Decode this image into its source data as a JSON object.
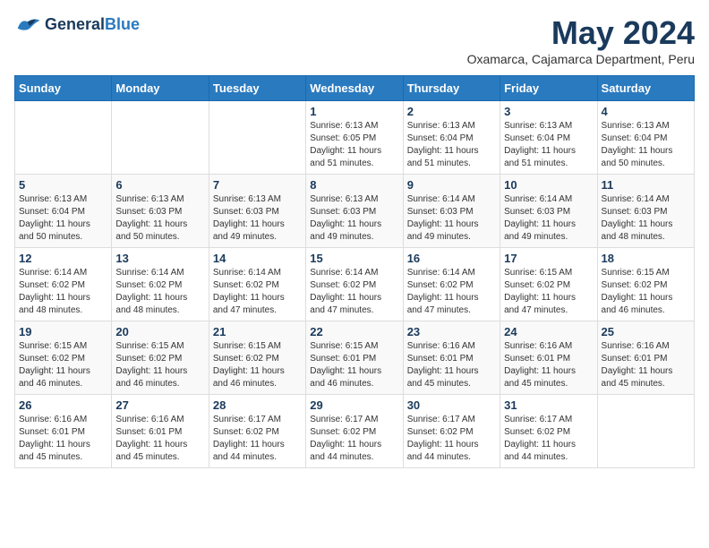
{
  "header": {
    "logo_line1": "General",
    "logo_line2": "Blue",
    "month": "May 2024",
    "location": "Oxamarca, Cajamarca Department, Peru"
  },
  "weekdays": [
    "Sunday",
    "Monday",
    "Tuesday",
    "Wednesday",
    "Thursday",
    "Friday",
    "Saturday"
  ],
  "weeks": [
    [
      {
        "day": "",
        "info": ""
      },
      {
        "day": "",
        "info": ""
      },
      {
        "day": "",
        "info": ""
      },
      {
        "day": "1",
        "info": "Sunrise: 6:13 AM\nSunset: 6:05 PM\nDaylight: 11 hours\nand 51 minutes."
      },
      {
        "day": "2",
        "info": "Sunrise: 6:13 AM\nSunset: 6:04 PM\nDaylight: 11 hours\nand 51 minutes."
      },
      {
        "day": "3",
        "info": "Sunrise: 6:13 AM\nSunset: 6:04 PM\nDaylight: 11 hours\nand 51 minutes."
      },
      {
        "day": "4",
        "info": "Sunrise: 6:13 AM\nSunset: 6:04 PM\nDaylight: 11 hours\nand 50 minutes."
      }
    ],
    [
      {
        "day": "5",
        "info": "Sunrise: 6:13 AM\nSunset: 6:04 PM\nDaylight: 11 hours\nand 50 minutes."
      },
      {
        "day": "6",
        "info": "Sunrise: 6:13 AM\nSunset: 6:03 PM\nDaylight: 11 hours\nand 50 minutes."
      },
      {
        "day": "7",
        "info": "Sunrise: 6:13 AM\nSunset: 6:03 PM\nDaylight: 11 hours\nand 49 minutes."
      },
      {
        "day": "8",
        "info": "Sunrise: 6:13 AM\nSunset: 6:03 PM\nDaylight: 11 hours\nand 49 minutes."
      },
      {
        "day": "9",
        "info": "Sunrise: 6:14 AM\nSunset: 6:03 PM\nDaylight: 11 hours\nand 49 minutes."
      },
      {
        "day": "10",
        "info": "Sunrise: 6:14 AM\nSunset: 6:03 PM\nDaylight: 11 hours\nand 49 minutes."
      },
      {
        "day": "11",
        "info": "Sunrise: 6:14 AM\nSunset: 6:03 PM\nDaylight: 11 hours\nand 48 minutes."
      }
    ],
    [
      {
        "day": "12",
        "info": "Sunrise: 6:14 AM\nSunset: 6:02 PM\nDaylight: 11 hours\nand 48 minutes."
      },
      {
        "day": "13",
        "info": "Sunrise: 6:14 AM\nSunset: 6:02 PM\nDaylight: 11 hours\nand 48 minutes."
      },
      {
        "day": "14",
        "info": "Sunrise: 6:14 AM\nSunset: 6:02 PM\nDaylight: 11 hours\nand 47 minutes."
      },
      {
        "day": "15",
        "info": "Sunrise: 6:14 AM\nSunset: 6:02 PM\nDaylight: 11 hours\nand 47 minutes."
      },
      {
        "day": "16",
        "info": "Sunrise: 6:14 AM\nSunset: 6:02 PM\nDaylight: 11 hours\nand 47 minutes."
      },
      {
        "day": "17",
        "info": "Sunrise: 6:15 AM\nSunset: 6:02 PM\nDaylight: 11 hours\nand 47 minutes."
      },
      {
        "day": "18",
        "info": "Sunrise: 6:15 AM\nSunset: 6:02 PM\nDaylight: 11 hours\nand 46 minutes."
      }
    ],
    [
      {
        "day": "19",
        "info": "Sunrise: 6:15 AM\nSunset: 6:02 PM\nDaylight: 11 hours\nand 46 minutes."
      },
      {
        "day": "20",
        "info": "Sunrise: 6:15 AM\nSunset: 6:02 PM\nDaylight: 11 hours\nand 46 minutes."
      },
      {
        "day": "21",
        "info": "Sunrise: 6:15 AM\nSunset: 6:02 PM\nDaylight: 11 hours\nand 46 minutes."
      },
      {
        "day": "22",
        "info": "Sunrise: 6:15 AM\nSunset: 6:01 PM\nDaylight: 11 hours\nand 46 minutes."
      },
      {
        "day": "23",
        "info": "Sunrise: 6:16 AM\nSunset: 6:01 PM\nDaylight: 11 hours\nand 45 minutes."
      },
      {
        "day": "24",
        "info": "Sunrise: 6:16 AM\nSunset: 6:01 PM\nDaylight: 11 hours\nand 45 minutes."
      },
      {
        "day": "25",
        "info": "Sunrise: 6:16 AM\nSunset: 6:01 PM\nDaylight: 11 hours\nand 45 minutes."
      }
    ],
    [
      {
        "day": "26",
        "info": "Sunrise: 6:16 AM\nSunset: 6:01 PM\nDaylight: 11 hours\nand 45 minutes."
      },
      {
        "day": "27",
        "info": "Sunrise: 6:16 AM\nSunset: 6:01 PM\nDaylight: 11 hours\nand 45 minutes."
      },
      {
        "day": "28",
        "info": "Sunrise: 6:17 AM\nSunset: 6:02 PM\nDaylight: 11 hours\nand 44 minutes."
      },
      {
        "day": "29",
        "info": "Sunrise: 6:17 AM\nSunset: 6:02 PM\nDaylight: 11 hours\nand 44 minutes."
      },
      {
        "day": "30",
        "info": "Sunrise: 6:17 AM\nSunset: 6:02 PM\nDaylight: 11 hours\nand 44 minutes."
      },
      {
        "day": "31",
        "info": "Sunrise: 6:17 AM\nSunset: 6:02 PM\nDaylight: 11 hours\nand 44 minutes."
      },
      {
        "day": "",
        "info": ""
      }
    ]
  ]
}
